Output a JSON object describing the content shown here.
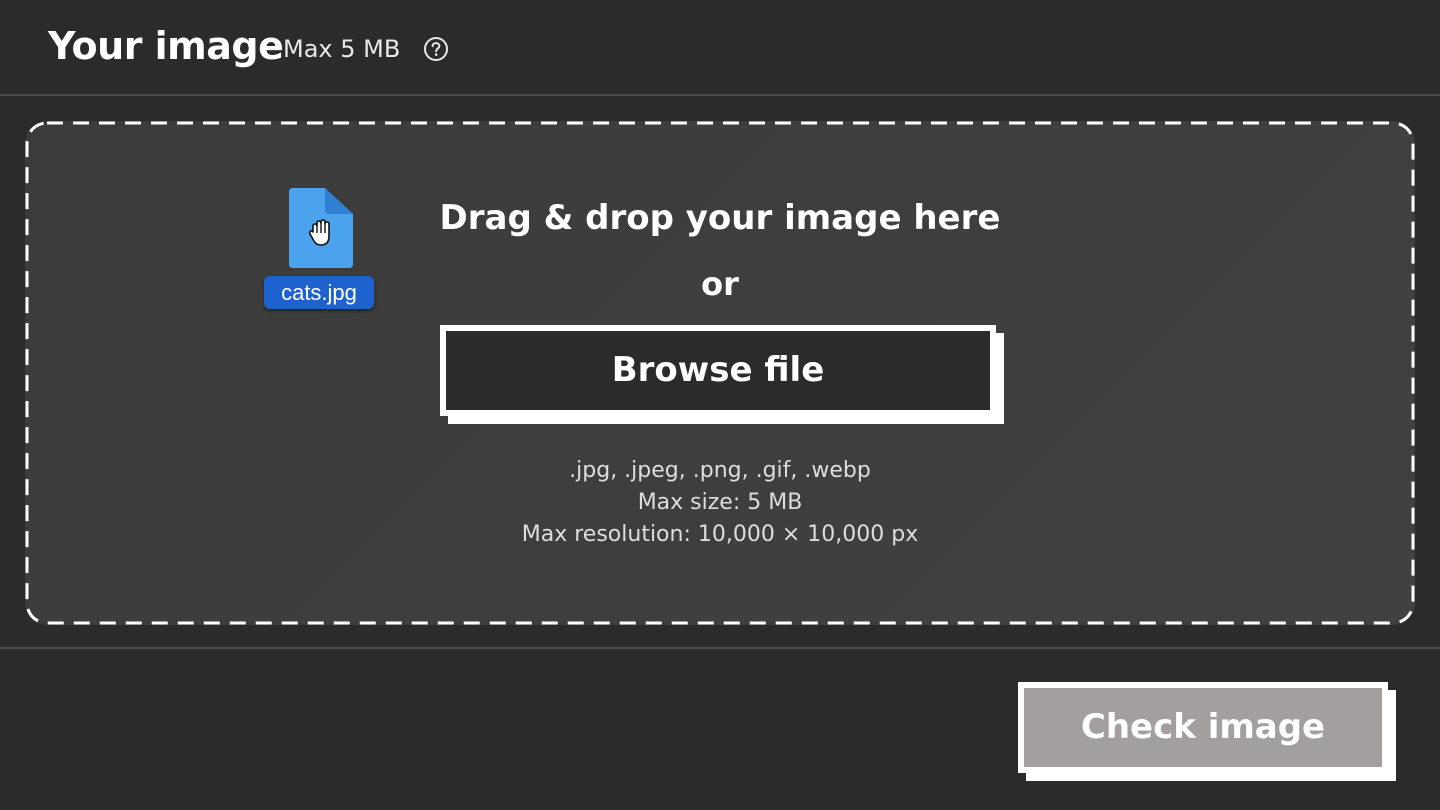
{
  "header": {
    "title": "Your image",
    "max_size_label": "Max 5 MB",
    "help_icon": "question-circle-icon"
  },
  "dropzone": {
    "file_icon": "document-icon",
    "cursor_icon": "grab-hand-icon",
    "dragged_file_name": "cats.jpg",
    "drag_text": "Drag & drop your image here",
    "or_text": "or",
    "browse_button": "Browse file",
    "formats": ".jpg, .jpeg, .png, .gif, .webp",
    "max_size": "Max size: 5 MB",
    "max_resolution": "Max resolution: 10,000 × 10,000 px"
  },
  "footer": {
    "check_button": "Check image"
  },
  "colors": {
    "background": "#2b2b2b",
    "dropzone_background": "#3e3e3e",
    "file_icon": "#4ba3ee",
    "file_label": "#1e62d0",
    "check_button_disabled": "#a39f9f",
    "border": "#ffffff"
  }
}
